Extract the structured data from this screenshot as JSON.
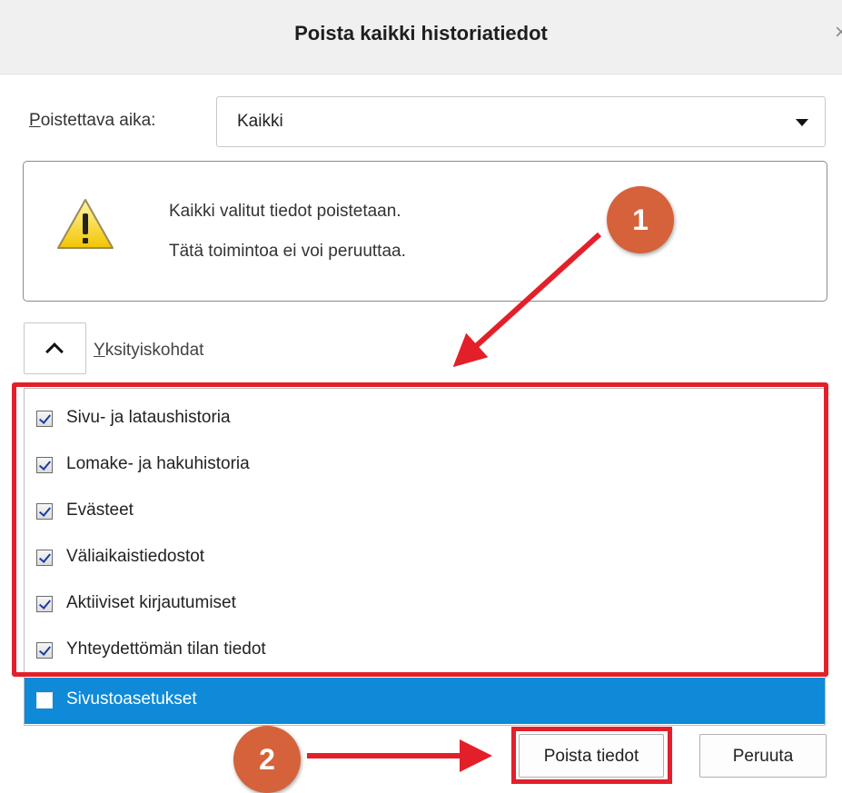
{
  "dialog": {
    "title": "Poista kaikki historiatiedot",
    "close_glyph": "×"
  },
  "time_range": {
    "label_underlined": "P",
    "label_rest": "oistettava aika:",
    "value": "Kaikki"
  },
  "warning": {
    "line1": "Kaikki valitut tiedot poistetaan.",
    "line2": "Tätä toimintoa ei voi peruuttaa."
  },
  "details": {
    "label_underlined": "Y",
    "label_rest": "ksityiskohdat"
  },
  "items": [
    {
      "label": "Sivu- ja lataushistoria",
      "checked": true
    },
    {
      "label": "Lomake- ja hakuhistoria",
      "checked": true
    },
    {
      "label": "Evästeet",
      "checked": true
    },
    {
      "label": "Väliaikaistiedostot",
      "checked": true
    },
    {
      "label": "Aktiiviset kirjautumiset",
      "checked": true
    },
    {
      "label": "Yhteydettömän tilan tiedot",
      "checked": true
    },
    {
      "label": "Sivustoasetukset",
      "checked": false,
      "selected": true
    }
  ],
  "buttons": {
    "clear": "Poista tiedot",
    "cancel": "Peruuta"
  },
  "annotations": {
    "step1": "1",
    "step2": "2"
  },
  "colors": {
    "highlight": "#e3202a",
    "badge": "#d5623a",
    "selection": "#0e8ad8"
  }
}
